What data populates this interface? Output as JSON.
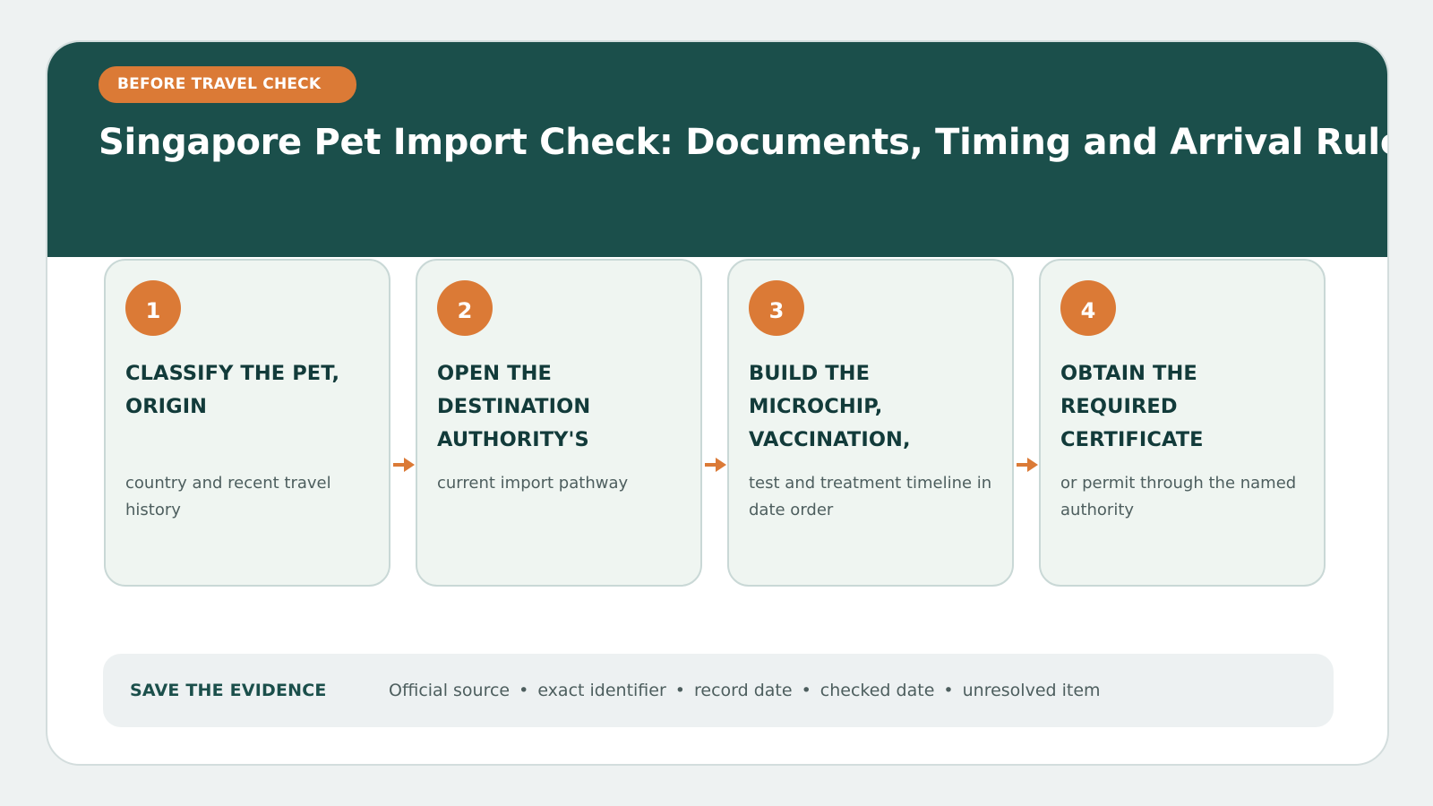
{
  "header": {
    "badge": "BEFORE TRAVEL CHECK",
    "title": "Singapore Pet Import Check: Documents, Timing and Arrival Rules"
  },
  "steps": [
    {
      "number": "1",
      "title": "CLASSIFY THE PET, ORIGIN",
      "description": "country and recent travel history"
    },
    {
      "number": "2",
      "title": "OPEN THE DESTINATION AUTHORITY'S",
      "description": "current import pathway"
    },
    {
      "number": "3",
      "title": "BUILD THE MICROCHIP, VACCINATION,",
      "description": "test and treatment timeline in date order"
    },
    {
      "number": "4",
      "title": "OBTAIN THE REQUIRED CERTIFICATE",
      "description": "or permit through the named authority"
    }
  ],
  "evidence": {
    "label": "SAVE THE EVIDENCE",
    "items": [
      "Official source",
      "exact identifier",
      "record date",
      "checked date",
      "unresolved item"
    ],
    "separator": "•"
  },
  "colors": {
    "header_bg": "#1b4f4b",
    "accent": "#db7a36",
    "step_bg": "#eff5f1",
    "step_title": "#123b3a"
  }
}
